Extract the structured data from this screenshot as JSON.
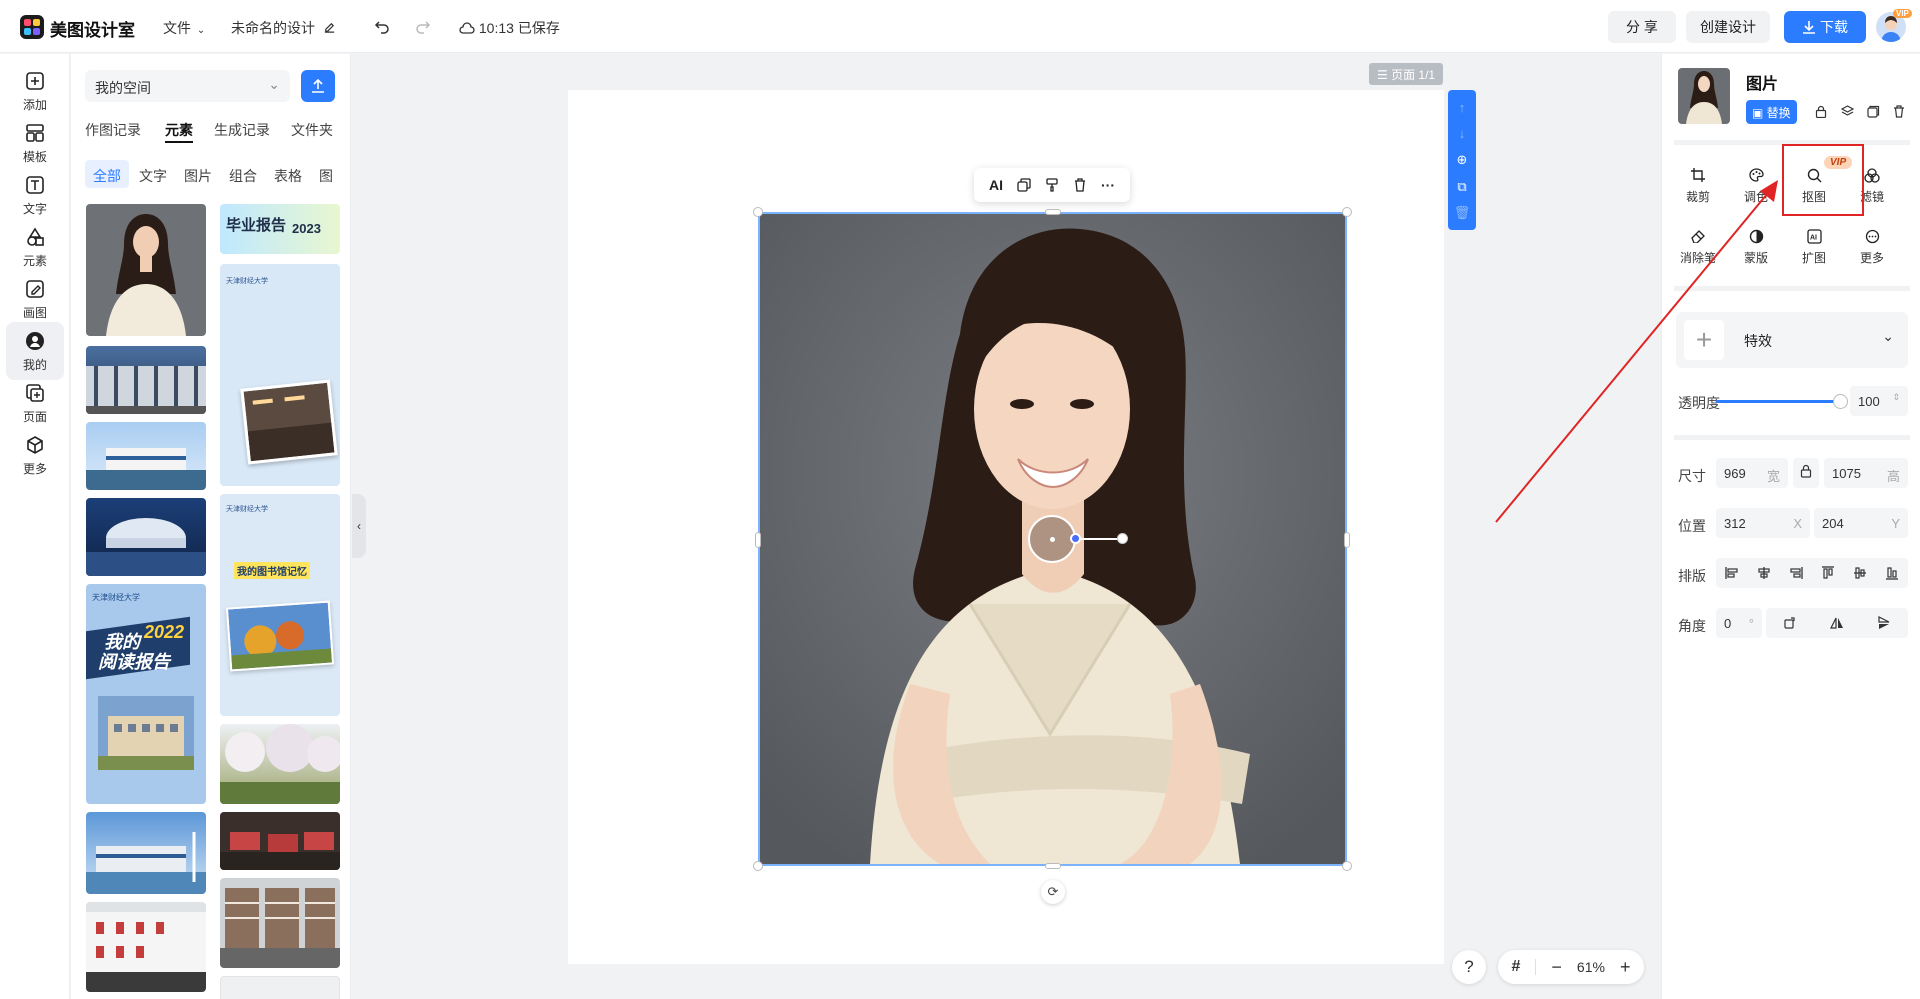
{
  "app": {
    "brand": "美图设计室",
    "menu_file": "文件",
    "doc_title": "未命名的设计",
    "saved_status": "10:13 已保存",
    "share_label": "分 享",
    "create_label": "创建设计",
    "download_label": "下载",
    "avatar_badge": "VIP"
  },
  "rail": {
    "items": [
      {
        "label": "添加",
        "icon": "plus-square-icon"
      },
      {
        "label": "模板",
        "icon": "template-icon"
      },
      {
        "label": "文字",
        "icon": "text-icon"
      },
      {
        "label": "元素",
        "icon": "shapes-icon"
      },
      {
        "label": "画图",
        "icon": "pencil-icon"
      },
      {
        "label": "我的",
        "icon": "user-icon"
      },
      {
        "label": "页面",
        "icon": "page-add-icon"
      },
      {
        "label": "更多",
        "icon": "cube-icon"
      }
    ],
    "active_index": 5
  },
  "panel": {
    "space_select": "我的空间",
    "tabs": [
      "作图记录",
      "元素",
      "生成记录",
      "文件夹"
    ],
    "active_tab": 1,
    "chips": [
      "全部",
      "文字",
      "图片",
      "组合",
      "表格",
      "图"
    ],
    "active_chip": 0,
    "card_texts": {
      "grad_report": "毕业报告",
      "grad_year": "2023",
      "university": "天津财经大学",
      "library_memory": "我的图书馆记忆",
      "reading_report_a": "我的",
      "reading_report_year": "2022",
      "reading_report_b": "阅读报告"
    }
  },
  "canvas": {
    "page_badge": "页面 1/1",
    "float_bar": {
      "ai_label": "AI"
    },
    "zoom_value": "61%",
    "help_glyph": "?"
  },
  "right_panel": {
    "title": "图片",
    "replace_label": "替换",
    "tools": [
      {
        "label": "裁剪",
        "icon": "crop-icon"
      },
      {
        "label": "调色",
        "icon": "palette-icon"
      },
      {
        "label": "抠图",
        "icon": "cutout-icon",
        "badge": "VIP"
      },
      {
        "label": "滤镜",
        "icon": "filter-icon"
      },
      {
        "label": "消除笔",
        "icon": "eraser-icon"
      },
      {
        "label": "蒙版",
        "icon": "mask-icon"
      },
      {
        "label": "扩图",
        "icon": "ai-expand-icon"
      },
      {
        "label": "更多",
        "icon": "more-icon"
      }
    ],
    "effects_label": "特效",
    "opacity_label": "透明度",
    "opacity_value": "100",
    "opacity_level": 1.0,
    "size_label": "尺寸",
    "width_value": "969",
    "width_suffix": "宽",
    "height_value": "1075",
    "height_suffix": "高",
    "position_label": "位置",
    "x_value": "312",
    "x_suffix": "X",
    "y_value": "204",
    "y_suffix": "Y",
    "arrange_label": "排版",
    "angle_label": "角度",
    "angle_value": "0",
    "angle_suffix": "°"
  },
  "colors": {
    "accent": "#2b7cff",
    "highlight": "#e02424"
  }
}
